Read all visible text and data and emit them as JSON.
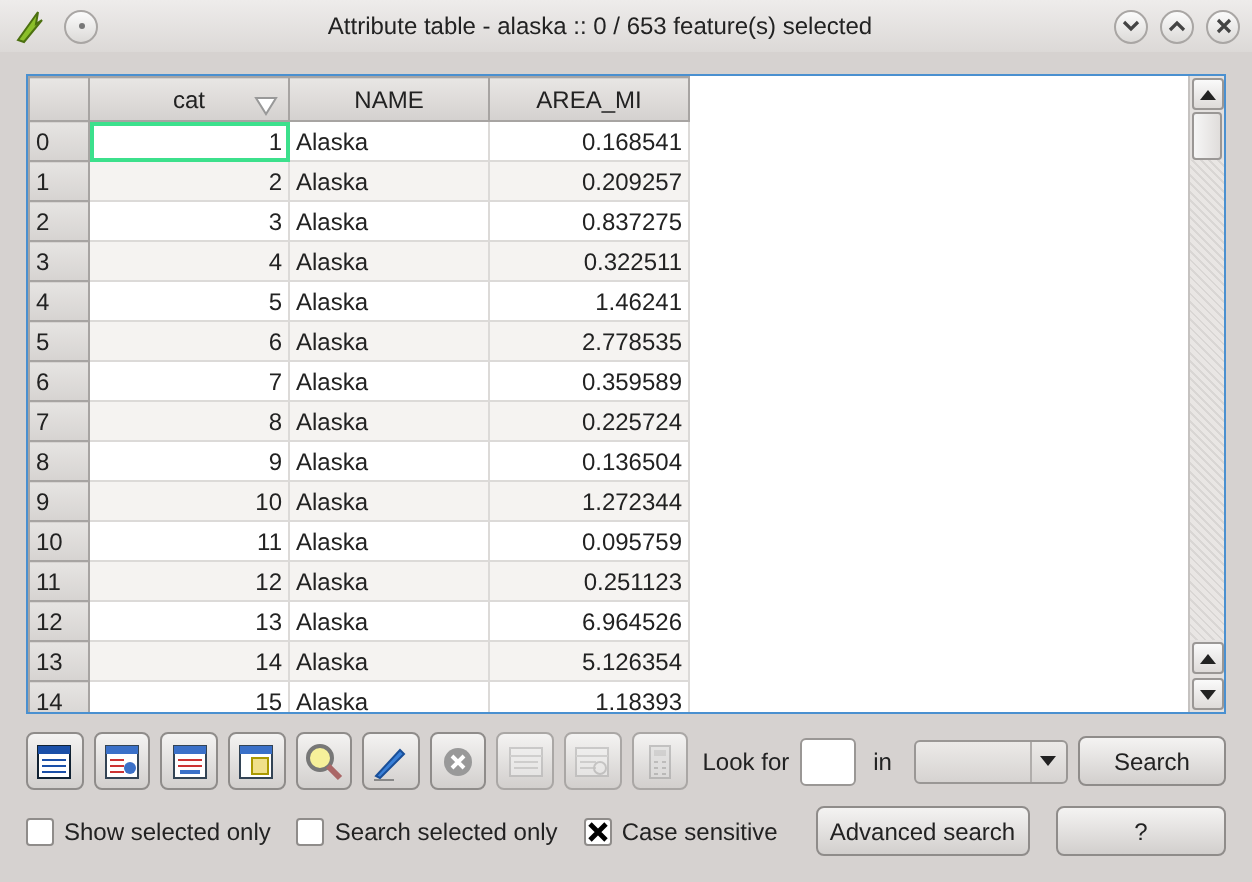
{
  "window": {
    "title": "Attribute table - alaska :: 0 / 653 feature(s) selected"
  },
  "table": {
    "columns": [
      {
        "label": "cat",
        "sorted": true
      },
      {
        "label": "NAME",
        "sorted": false
      },
      {
        "label": "AREA_MI",
        "sorted": false
      }
    ],
    "rows": [
      {
        "index": "0",
        "cells": [
          "1",
          "Alaska",
          "0.168541"
        ],
        "current": true
      },
      {
        "index": "1",
        "cells": [
          "2",
          "Alaska",
          "0.209257"
        ],
        "current": false
      },
      {
        "index": "2",
        "cells": [
          "3",
          "Alaska",
          "0.837275"
        ],
        "current": false
      },
      {
        "index": "3",
        "cells": [
          "4",
          "Alaska",
          "0.322511"
        ],
        "current": false
      },
      {
        "index": "4",
        "cells": [
          "5",
          "Alaska",
          "1.46241"
        ],
        "current": false
      },
      {
        "index": "5",
        "cells": [
          "6",
          "Alaska",
          "2.778535"
        ],
        "current": false
      },
      {
        "index": "6",
        "cells": [
          "7",
          "Alaska",
          "0.359589"
        ],
        "current": false
      },
      {
        "index": "7",
        "cells": [
          "8",
          "Alaska",
          "0.225724"
        ],
        "current": false
      },
      {
        "index": "8",
        "cells": [
          "9",
          "Alaska",
          "0.136504"
        ],
        "current": false
      },
      {
        "index": "9",
        "cells": [
          "10",
          "Alaska",
          "1.272344"
        ],
        "current": false
      },
      {
        "index": "10",
        "cells": [
          "11",
          "Alaska",
          "0.095759"
        ],
        "current": false
      },
      {
        "index": "11",
        "cells": [
          "12",
          "Alaska",
          "0.251123"
        ],
        "current": false
      },
      {
        "index": "12",
        "cells": [
          "13",
          "Alaska",
          "6.964526"
        ],
        "current": false
      },
      {
        "index": "13",
        "cells": [
          "14",
          "Alaska",
          "5.126354"
        ],
        "current": false
      },
      {
        "index": "14",
        "cells": [
          "15",
          "Alaska",
          "1.18393"
        ],
        "current": false
      }
    ]
  },
  "toolbar": [
    {
      "disabled": false
    },
    {
      "disabled": false
    },
    {
      "disabled": false
    },
    {
      "disabled": false
    },
    {
      "disabled": false
    },
    {
      "disabled": false
    },
    {
      "disabled": false
    },
    {
      "disabled": true
    },
    {
      "disabled": true
    },
    {
      "disabled": true
    }
  ],
  "search": {
    "label": "Look for",
    "in_label": "in",
    "button": "Search"
  },
  "options": [
    {
      "label": "Show selected only",
      "checked": false
    },
    {
      "label": "Search selected only",
      "checked": false
    },
    {
      "label": "Case sensitive",
      "checked": true
    }
  ],
  "buttons": [
    "Advanced search",
    "?"
  ]
}
